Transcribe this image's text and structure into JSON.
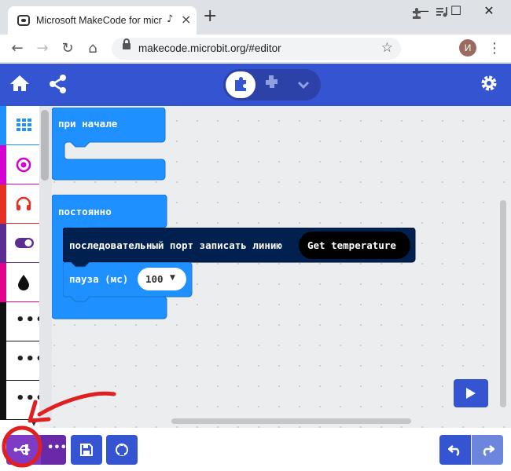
{
  "browser": {
    "tab_title": "Microsoft MakeCode for micro:bit",
    "tab_audio_icon": "audio-icon",
    "new_tab": "+",
    "url": "makecode.microbit.org/#editor",
    "avatar_letter": "И",
    "window_controls": [
      "—",
      "☐",
      "✕"
    ]
  },
  "header": {
    "home_icon": "home-icon",
    "share_icon": "share-icon",
    "settings_icon": "gear-icon",
    "editor_toggle": [
      "blocks",
      "javascript",
      "more"
    ]
  },
  "toolbox": {
    "categories": [
      {
        "name": "basic",
        "color": "#1e90ff",
        "icon": "grid-icon"
      },
      {
        "name": "input",
        "color": "#d400d4",
        "icon": "radio-target-icon"
      },
      {
        "name": "music",
        "color": "#e63022",
        "icon": "headphones-icon"
      },
      {
        "name": "led",
        "color": "#5c2d91",
        "icon": "toggle-icon"
      },
      {
        "name": "radio",
        "color": "#e3008c",
        "icon": "drop-icon"
      },
      {
        "name": "more1",
        "label": "•••"
      },
      {
        "name": "more2",
        "label": "•••"
      },
      {
        "name": "more3",
        "label": "•••"
      }
    ]
  },
  "blocks": {
    "on_start": "при начале",
    "forever": "постоянно",
    "serial_write": "последовательный порт записать линию",
    "temperature": "Get temperature",
    "pause_label": "пауза (мс)",
    "pause_value": "100",
    "pause_dropdown": "▼"
  },
  "colors": {
    "header": "#3454d1",
    "basic_block": "#1e90ff",
    "serial_block": "#002050",
    "annotation": "#e02020",
    "download_btn": "#7e3cc6"
  },
  "bottombar": {
    "download_icon": "usb-icon",
    "more_label": "•••",
    "save_icon": "save-icon",
    "github_icon": "github-icon",
    "undo_icon": "undo-icon",
    "redo_icon": "redo-icon"
  }
}
